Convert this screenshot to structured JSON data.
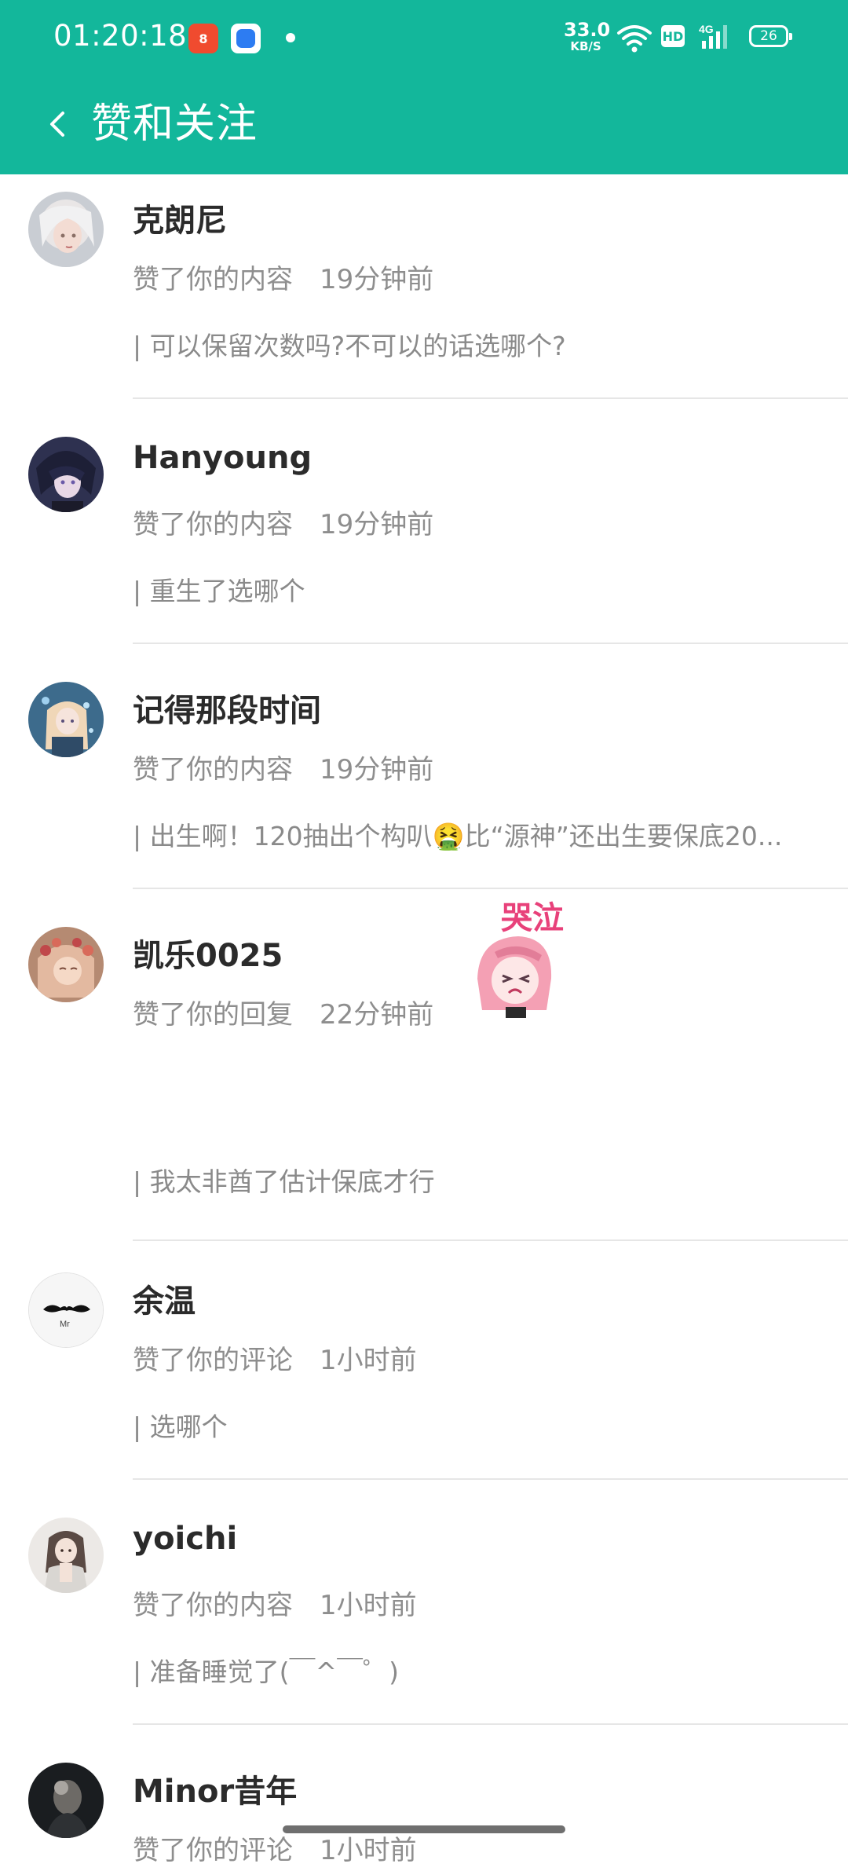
{
  "status_bar": {
    "time": "01:20:18",
    "app1_label": "8",
    "net_speed_value": "33.0",
    "net_speed_unit": "KB/S",
    "hd": "HD",
    "signal": "4G",
    "battery": "26"
  },
  "header": {
    "title": "赞和关注",
    "background_color": "#13b79b"
  },
  "items": [
    {
      "name": "克朗尼",
      "action": "赞了你的内容",
      "time": "19分钟前",
      "content": "| 可以保留次数吗?不可以的话选哪个?",
      "avatar_icon": "avatar-girl-white-hair"
    },
    {
      "name": "Hanyoung",
      "action": "赞了你的内容",
      "time": "19分钟前",
      "content": "| 重生了选哪个",
      "avatar_icon": "avatar-anime-boy"
    },
    {
      "name": "记得那段时间",
      "action": "赞了你的内容",
      "time": "19分钟前",
      "content": "| 出生啊！120抽出个构叭🤮比“源神”还出生要保底20...",
      "avatar_icon": "avatar-anime-girl-blue"
    },
    {
      "name": "凯乐0025",
      "action": "赞了你的回复",
      "time": "22分钟前",
      "content": "| 我太非酋了估计保底才行",
      "avatar_icon": "avatar-anime-girl-flowers",
      "sticker_text": "哭泣"
    },
    {
      "name": "余温",
      "action": "赞了你的评论",
      "time": "1小时前",
      "content": "| 选哪个",
      "avatar_icon": "avatar-mustache",
      "avatar_text": "Mr"
    },
    {
      "name": "yoichi",
      "action": "赞了你的内容",
      "time": "1小时前",
      "content": "| 准备睡觉了(￣^￣゜)",
      "avatar_icon": "avatar-girl-photo"
    },
    {
      "name": "Minor昔年",
      "action": "赞了你的评论",
      "time": "1小时前",
      "content": "",
      "avatar_icon": "avatar-dark-photo"
    }
  ]
}
